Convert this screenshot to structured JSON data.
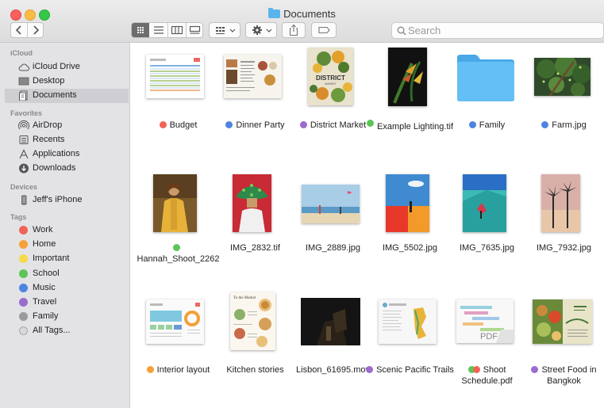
{
  "window": {
    "title": "Documents"
  },
  "toolbar": {
    "back_icon": "chevron-left-icon",
    "forward_icon": "chevron-right-icon",
    "view_modes": [
      "icon-view-icon",
      "list-view-icon",
      "column-view-icon",
      "gallery-view-icon"
    ],
    "group_icon": "group-by-icon",
    "action_icon": "gear-icon",
    "share_icon": "share-icon",
    "tag_icon": "tag-icon"
  },
  "search": {
    "placeholder": "Search",
    "value": ""
  },
  "sidebar": {
    "sections": [
      {
        "label": "iCloud",
        "items": [
          {
            "label": "iCloud Drive",
            "icon": "cloud-icon"
          },
          {
            "label": "Desktop",
            "icon": "desktop-icon"
          },
          {
            "label": "Documents",
            "icon": "documents-icon",
            "selected": true
          }
        ]
      },
      {
        "label": "Favorites",
        "items": [
          {
            "label": "AirDrop",
            "icon": "airdrop-icon"
          },
          {
            "label": "Recents",
            "icon": "recents-icon"
          },
          {
            "label": "Applications",
            "icon": "applications-icon"
          },
          {
            "label": "Downloads",
            "icon": "downloads-icon"
          }
        ]
      },
      {
        "label": "Devices",
        "items": [
          {
            "label": "Jeff's iPhone",
            "icon": "iphone-icon"
          }
        ]
      },
      {
        "label": "Tags",
        "items": [
          {
            "label": "Work",
            "color": "#f06357"
          },
          {
            "label": "Home",
            "color": "#f7a03a"
          },
          {
            "label": "Important",
            "color": "#f7d94c"
          },
          {
            "label": "School",
            "color": "#5dc557"
          },
          {
            "label": "Music",
            "color": "#4d84e0"
          },
          {
            "label": "Travel",
            "color": "#9a6ccd"
          },
          {
            "label": "Family",
            "color": "#9a9a9e"
          },
          {
            "label": "All Tags...",
            "color": "#c8c8cc"
          }
        ]
      }
    ]
  },
  "files": [
    {
      "name": "Budget",
      "tags": [
        "#f06357"
      ]
    },
    {
      "name": "Dinner Party",
      "tags": [
        "#4d84e0"
      ]
    },
    {
      "name": "District Market",
      "tags": [
        "#9a6ccd"
      ]
    },
    {
      "name": "Example Lighting.tif",
      "tags": [
        "#5dc557"
      ]
    },
    {
      "name": "Family",
      "tags": [
        "#4d84e0"
      ]
    },
    {
      "name": "Farm.jpg",
      "tags": [
        "#4d84e0"
      ]
    },
    {
      "name": "Hannah_Shoot_2262",
      "tags": [
        "#5dc557"
      ]
    },
    {
      "name": "IMG_2832.tif",
      "tags": []
    },
    {
      "name": "IMG_2889.jpg",
      "tags": []
    },
    {
      "name": "IMG_5502.jpg",
      "tags": []
    },
    {
      "name": "IMG_7635.jpg",
      "tags": []
    },
    {
      "name": "IMG_7932.jpg",
      "tags": []
    },
    {
      "name": "Interior layout",
      "tags": [
        "#f7a03a"
      ]
    },
    {
      "name": "Kitchen stories",
      "tags": []
    },
    {
      "name": "Lisbon_61695.mov",
      "tags": []
    },
    {
      "name": "Scenic Pacific Trails",
      "tags": [
        "#9a6ccd"
      ]
    },
    {
      "name": "Shoot Schedule.pdf",
      "tags": [
        "#5dc557",
        "#f06357"
      ]
    },
    {
      "name": "Street Food in Bangkok",
      "tags": [
        "#9a6ccd"
      ]
    }
  ],
  "thumbnails": {
    "district_market_title": "DISTRICT",
    "district_market_sub": "MARKET",
    "kitchen_title": "To the Market",
    "pdf_badge": "PDF"
  }
}
